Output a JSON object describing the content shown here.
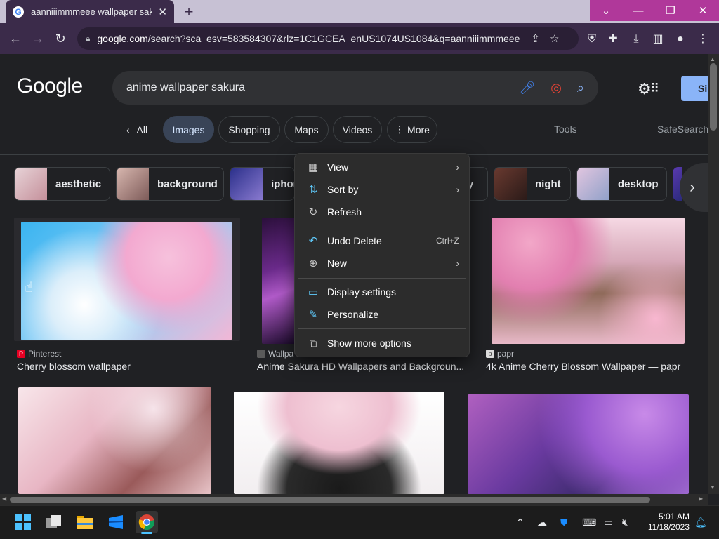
{
  "browser": {
    "tab_title": "aanniiimmmeee wallpaper sakura",
    "tab_favicon": "G",
    "new_tab": "+",
    "url_domain": "google.com",
    "url_rest": "/search?sca_esv=583584307&rlz=1C1GCEA_enUS1074US1084&q=aanniiimmmeee+...",
    "window_controls": {
      "dropdown": "⌄",
      "minimize": "—",
      "restore": "❐",
      "close": "✕"
    }
  },
  "google": {
    "logo": "Google",
    "query": "anime wallpaper sakura",
    "signin_label": "Si",
    "tabs": [
      {
        "label": "All"
      },
      {
        "label": "Images"
      },
      {
        "label": "Shopping"
      },
      {
        "label": "Maps"
      },
      {
        "label": "Videos"
      },
      {
        "label": "More"
      }
    ],
    "tools_label": "Tools",
    "safesearch_label": "SafeSearch"
  },
  "chips": [
    {
      "label": "aesthetic",
      "color": "#d9c2c8"
    },
    {
      "label": "background",
      "color": "#b08a86"
    },
    {
      "label": "iphone",
      "color": "#3a3f9a"
    },
    {
      "label": "y",
      "color": "#b88aa8"
    },
    {
      "label": "night",
      "color": "#4a2f2a"
    },
    {
      "label": "desktop",
      "color": "#c6a4c4"
    }
  ],
  "results": [
    {
      "source": "Pinterest",
      "caption": "Cherry blossom wallpaper"
    },
    {
      "source": "Wallpa",
      "caption": "Anime Sakura HD Wallpapers and Backgroun..."
    },
    {
      "source": "papr",
      "caption": "4k Anime Cherry Blossom Wallpaper — papr"
    }
  ],
  "context_menu": {
    "items": [
      {
        "label": "View",
        "icon": "view-icon",
        "glyph": "▦"
      },
      {
        "label": "Sort by",
        "icon": "sort-icon",
        "glyph": "⇅"
      },
      {
        "label": "Refresh",
        "icon": "refresh-icon",
        "glyph": "↻"
      },
      {
        "label": "Undo Delete",
        "icon": "undo-icon",
        "glyph": "↶",
        "shortcut": "Ctrl+Z"
      },
      {
        "label": "New",
        "icon": "new-icon",
        "glyph": "⊕"
      },
      {
        "label": "Display settings",
        "icon": "display-icon",
        "glyph": "▭"
      },
      {
        "label": "Personalize",
        "icon": "pen-icon",
        "glyph": "✎"
      },
      {
        "label": "Show more options",
        "icon": "more-options-icon",
        "glyph": "⧉"
      }
    ],
    "submenu_arrow": "›"
  },
  "taskbar": {
    "time": "5:01 AM",
    "date": "11/18/2023"
  },
  "colors": {
    "accent_blue": "#8ab4f8",
    "active_tab": "#394457",
    "window_controls": "#b0389a"
  }
}
